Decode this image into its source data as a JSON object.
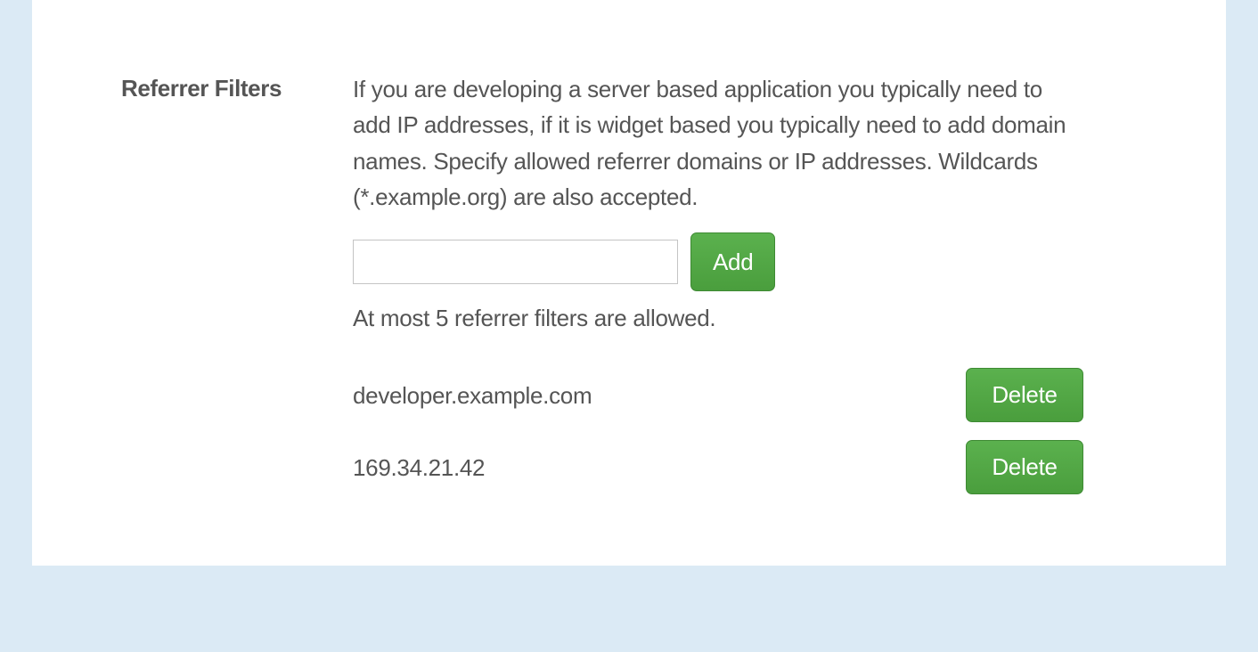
{
  "section": {
    "title": "Referrer Filters",
    "description": "If you are developing a server based application you typically need to add IP addresses, if it is widget based you typically need to add domain names. Specify allowed referrer domains or IP addresses. Wildcards (*.example.org) are also accepted.",
    "limit_note": "At most 5 referrer filters are allowed.",
    "add_label": "Add",
    "delete_label": "Delete",
    "input_value": ""
  },
  "filters": [
    {
      "value": "developer.example.com"
    },
    {
      "value": "169.34.21.42"
    }
  ]
}
